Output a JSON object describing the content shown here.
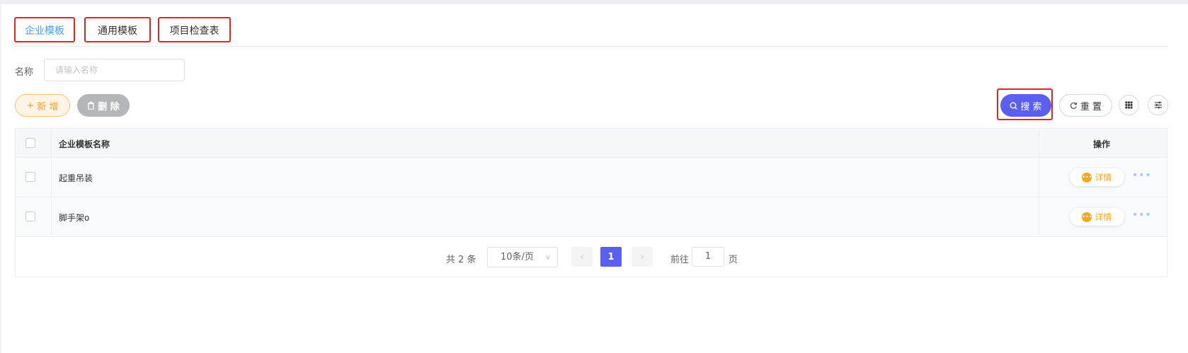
{
  "tabs": [
    {
      "label": "企业模板",
      "active": true
    },
    {
      "label": "通用模板",
      "active": false
    },
    {
      "label": "项目检查表",
      "active": false
    }
  ],
  "filter": {
    "label": "名称",
    "placeholder": "请输入名称",
    "value": ""
  },
  "toolbar": {
    "add_label": "新 增",
    "delete_label": "删 除",
    "search_label": "搜 索",
    "reset_label": "重 置"
  },
  "table": {
    "headers": {
      "name": "企业模板名称",
      "operations": "操作"
    },
    "rows": [
      {
        "name": "起重吊装",
        "detail_label": "详情"
      },
      {
        "name": "脚手架o",
        "detail_label": "详情"
      }
    ]
  },
  "pagination": {
    "total_text": "共 2 条",
    "page_size": "10条/页",
    "current_page": "1",
    "goto_label": "前往",
    "goto_value": "1",
    "page_suffix": "页"
  },
  "colors": {
    "primary": "#5a5ff0",
    "accent_orange": "#f5a623",
    "tab_active": "#409eff",
    "highlight_border": "#e8231a"
  }
}
